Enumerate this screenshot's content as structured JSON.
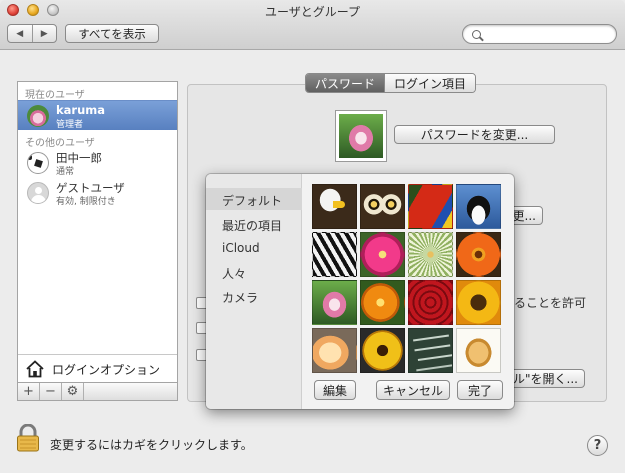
{
  "window": {
    "title": "ユーザとグループ"
  },
  "toolbar": {
    "back": "◀",
    "forward": "▶",
    "show_all": "すべてを表示",
    "search_placeholder": ""
  },
  "users": {
    "current_header": "現在のユーザ",
    "current": {
      "name": "karuma",
      "role": "管理者"
    },
    "others_header": "その他のユーザ",
    "others": [
      {
        "name": "田中一郎",
        "role": "通常"
      },
      {
        "name": "ゲストユーザ",
        "role": "有効, 制限付き"
      }
    ],
    "login_options": "ログインオプション",
    "buttons": {
      "add": "+",
      "remove": "−",
      "gear": "⚙"
    }
  },
  "tabs": [
    {
      "label": "パスワード",
      "active": true
    },
    {
      "label": "ログイン項目",
      "active": false
    }
  ],
  "panel": {
    "change_password": "パスワードを変更...",
    "button_fragment": "更...",
    "allow_fragment": "ることを許可",
    "open_fragment": "ル\"を開く..."
  },
  "popover": {
    "sources": [
      "デフォルト",
      "最近の項目",
      "iCloud",
      "人々",
      "カメラ"
    ],
    "selected_source": "デフォルト",
    "pictures": [
      "eagle",
      "owl",
      "parrot",
      "penguin",
      "zebra",
      "pink-flower",
      "dandelion",
      "gerbera",
      "lotus",
      "orange-flower",
      "red-rose",
      "sunflower",
      "yellow-rose",
      "yellow-daisy",
      "chalkboard",
      "fortune-cookie"
    ],
    "edit": "編集",
    "cancel": "キャンセル",
    "done": "完了"
  },
  "lock": {
    "text": "変更するにはカギをクリックします。"
  },
  "help": "?"
}
